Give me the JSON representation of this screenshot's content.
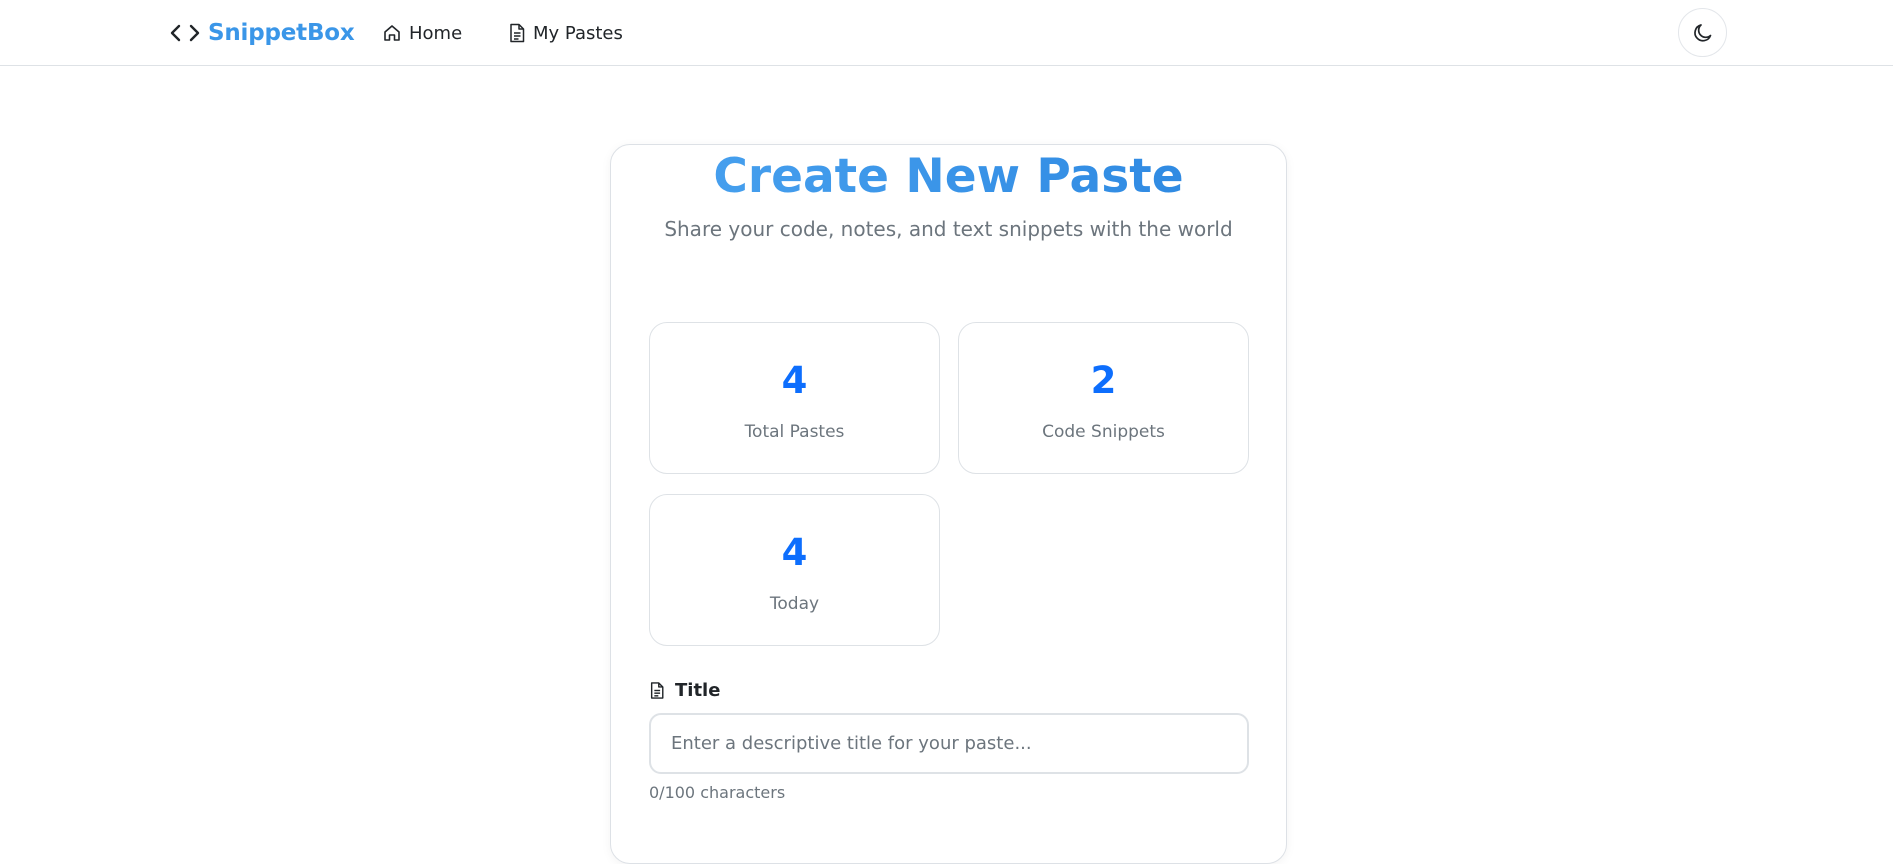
{
  "navbar": {
    "brand": "SnippetBox",
    "brand_icon": "code-brackets-icon",
    "links": [
      {
        "label": "Home",
        "icon": "house-icon"
      },
      {
        "label": "My Pastes",
        "icon": "file-text-icon"
      }
    ],
    "theme_toggle_icon": "moon-icon"
  },
  "main": {
    "title": "Create New Paste",
    "subtitle": "Share your code, notes, and text snippets with the world",
    "stats": [
      {
        "value": "4",
        "label": "Total Pastes"
      },
      {
        "value": "2",
        "label": "Code Snippets"
      },
      {
        "value": "4",
        "label": "Today"
      }
    ],
    "form": {
      "title_label": "Title",
      "title_icon": "file-text-icon",
      "title_value": "",
      "title_placeholder": "Enter a descriptive title for your paste...",
      "char_count": "0/100 characters"
    }
  },
  "colors": {
    "brand": "#3a96e8",
    "stat_value": "#0d6efd",
    "muted": "#6c757d",
    "border": "#dee2e6"
  }
}
